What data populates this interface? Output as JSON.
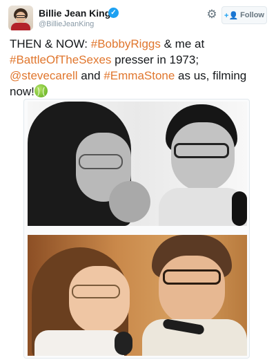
{
  "user": {
    "display_name": "Billie Jean King",
    "handle": "@BillieJeanKing",
    "verified_icon": "verified-badge-icon"
  },
  "actions": {
    "settings_icon": "gear-icon",
    "follow_label": "Follow",
    "follow_icon": "follow-person-plus-icon"
  },
  "tweet": {
    "seg1": "THEN & NOW: ",
    "tag1": "#BobbyRiggs",
    "seg2": " & me at ",
    "tag2": "#BattleOfTheSexes",
    "seg3": " presser in 1973; ",
    "tag3": "@stevecarell",
    "seg4": " and ",
    "tag4": "#EmmaStone",
    "seg5": " as us, filming now!",
    "emoji": "tennis-ball-emoji"
  },
  "colors": {
    "link": "#e0762d",
    "text": "#14171a",
    "muted": "#8899a6",
    "verified": "#1da1f2"
  },
  "media": {
    "photos": [
      {
        "style": "black-and-white 1973 press photo"
      },
      {
        "style": "color film still"
      }
    ]
  }
}
